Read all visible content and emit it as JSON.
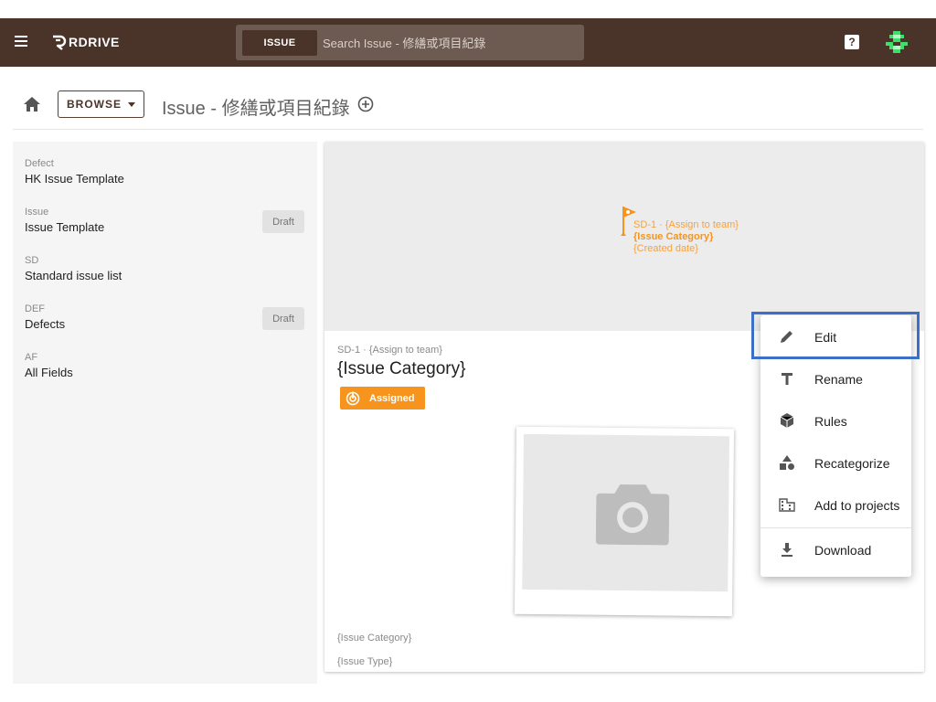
{
  "colors": {
    "appbar": "#4a3429",
    "accent": "#f7941d",
    "highlight": "#3d6fc6"
  },
  "appbar": {
    "logo_text": "RDRIVE",
    "search": {
      "scope_label": "ISSUE",
      "placeholder": "Search Issue - 修繕或項目紀錄"
    },
    "help_label": "?"
  },
  "toolbar": {
    "browse_label": "BROWSE",
    "title": "Issue - 修繕或項目紀錄"
  },
  "sidebar": {
    "items": [
      {
        "code": "Defect",
        "name": "HK Issue Template",
        "badge": ""
      },
      {
        "code": "Issue",
        "name": "Issue Template",
        "badge": "Draft"
      },
      {
        "code": "SD",
        "name": "Standard issue list",
        "badge": ""
      },
      {
        "code": "DEF",
        "name": "Defects",
        "badge": "Draft"
      },
      {
        "code": "AF",
        "name": "All Fields",
        "badge": ""
      }
    ]
  },
  "card": {
    "hero": {
      "line1": "SD-1 · {Assign to team}",
      "line2": "{Issue Category}",
      "line3": "{Created date}"
    },
    "subtitle": "SD-1 · {Assign to team}",
    "title": "{Issue Category}",
    "status": "Assigned",
    "footer_line1": "{Issue Category}",
    "footer_line2": "{Issue Type}"
  },
  "context_menu": {
    "items": [
      {
        "label": "Edit",
        "icon": "pencil-icon"
      },
      {
        "label": "Rename",
        "icon": "text-icon"
      },
      {
        "label": "Rules",
        "icon": "cube-icon"
      },
      {
        "label": "Recategorize",
        "icon": "shapes-icon"
      },
      {
        "label": "Add to projects",
        "icon": "building-icon"
      },
      {
        "label": "Download",
        "icon": "download-icon"
      }
    ]
  }
}
